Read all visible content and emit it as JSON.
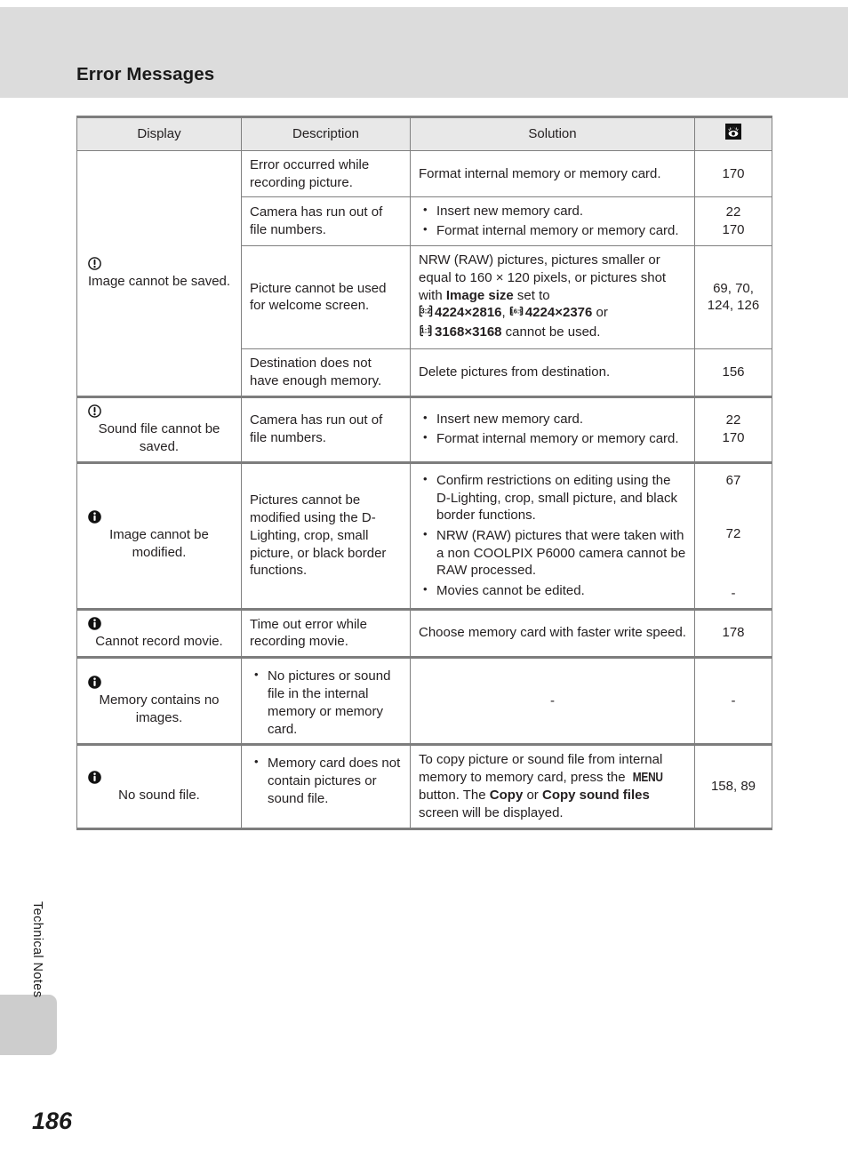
{
  "page": {
    "header_title": "Error Messages",
    "chapter_label": "Technical Notes",
    "page_number": "186"
  },
  "table": {
    "headers": {
      "display": "Display",
      "description": "Description",
      "solution": "Solution",
      "reference_icon": "book-reference-icon"
    },
    "rows": [
      {
        "display_icon": "warning-circle-icon",
        "display_text": "Image cannot be saved.",
        "sub_rows": [
          {
            "description": "Error occurred while recording picture.",
            "solution_type": "plain",
            "solution": "Format internal memory or memory card.",
            "reference": "170"
          },
          {
            "description": "Camera has run out of file numbers.",
            "solution_type": "bullets",
            "solution_items": [
              "Insert new memory card.",
              "Format internal memory or memory card."
            ],
            "reference": "22\n170"
          },
          {
            "description": "Picture cannot be used for welcome screen.",
            "solution_type": "rich_welcome",
            "solution_parts": {
              "lead": "NRW (RAW) pictures, pictures smaller or equal to 160 × 120 pixels, or pictures shot with ",
              "bold_image_size": "Image size",
              "mid": " set to",
              "size1_ratio": "3:2",
              "size1": "4224×2816",
              "sep1": ", ",
              "size2_ratio": "16:9",
              "size2": "4224×2376",
              "sep2": " or",
              "size3_ratio": "1:1",
              "size3": "3168×3168",
              "tail": " cannot be used."
            },
            "reference": "69, 70,\n124, 126"
          },
          {
            "description": "Destination does not have enough memory.",
            "solution_type": "plain",
            "solution": "Delete pictures from destination.",
            "reference": "156"
          }
        ]
      },
      {
        "display_icon": "warning-circle-icon",
        "display_text": "Sound file cannot be saved.",
        "sub_rows": [
          {
            "description": "Camera has run out of file numbers.",
            "solution_type": "bullets",
            "solution_items": [
              "Insert new memory card.",
              "Format internal memory or memory card."
            ],
            "reference": "22\n170"
          }
        ]
      },
      {
        "display_icon": "info-circle-icon",
        "display_text": "Image cannot be modified.",
        "sub_rows": [
          {
            "description": "Pictures cannot be modified using the D-Lighting, crop, small picture, or black border functions.",
            "solution_type": "bullets_multiref",
            "solution_items": [
              "Confirm restrictions on editing using the D-Lighting, crop, small picture, and black border functions.",
              "NRW (RAW) pictures that were taken with a non COOLPIX P6000 camera cannot be RAW processed.",
              "Movies cannot be edited."
            ],
            "reference_lines": [
              "67",
              "72",
              "-"
            ]
          }
        ]
      },
      {
        "display_icon": "info-circle-icon",
        "display_text": "Cannot record movie.",
        "sub_rows": [
          {
            "description": "Time out error while recording movie.",
            "solution_type": "plain",
            "solution": "Choose memory card with faster write speed.",
            "reference": "178"
          }
        ]
      },
      {
        "display_icon": "info-circle-icon",
        "display_text": "Memory contains no images.",
        "sub_rows": [
          {
            "description_type": "bullets",
            "description_items": [
              "No pictures or sound file in the internal memory or memory card."
            ],
            "solution_type": "plain",
            "solution": "-",
            "reference": "-"
          }
        ]
      },
      {
        "display_icon": "info-circle-icon",
        "display_text": "No sound file.",
        "sub_rows": [
          {
            "description_type": "bullets",
            "description_items": [
              "Memory card does not contain pictures or sound file."
            ],
            "solution_type": "rich_copy",
            "solution_parts": {
              "lead": "To copy picture or sound file from internal memory to memory card, press the ",
              "menu_glyph": "MENU",
              "mid": " button. The ",
              "bold_copy": "Copy",
              "or": " or ",
              "bold_copy_sound": "Copy sound files",
              "tail": " screen will be displayed."
            },
            "reference": "158, 89"
          }
        ]
      }
    ]
  }
}
